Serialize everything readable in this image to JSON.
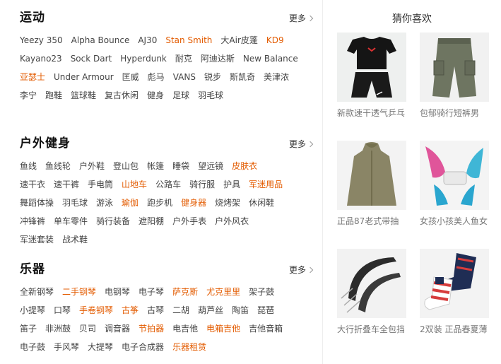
{
  "sections": [
    {
      "title": "运动",
      "more": "更多",
      "rows": [
        [
          {
            "t": "Yeezy 350"
          },
          {
            "t": "Alpha Bounce"
          },
          {
            "t": "AJ30"
          },
          {
            "t": "Stan Smith",
            "hot": true
          },
          {
            "t": "大Air皮蓬"
          },
          {
            "t": "KD9",
            "hot": true
          }
        ],
        [
          {
            "t": "Kayano23"
          },
          {
            "t": "Sock Dart"
          },
          {
            "t": "Hyperdunk"
          },
          {
            "t": "耐克"
          },
          {
            "t": "阿迪达斯"
          },
          {
            "t": "New Balance"
          }
        ],
        [
          {
            "t": "亚瑟士",
            "hot": true
          },
          {
            "t": "Under Armour"
          },
          {
            "t": "匡威"
          },
          {
            "t": "彪马"
          },
          {
            "t": "VANS"
          },
          {
            "t": "锐步"
          },
          {
            "t": "斯凯奇"
          },
          {
            "t": "美津浓"
          }
        ],
        [
          {
            "t": "李宁"
          },
          {
            "t": "跑鞋"
          },
          {
            "t": "篮球鞋"
          },
          {
            "t": "复古休闲"
          },
          {
            "t": "健身"
          },
          {
            "t": "足球"
          },
          {
            "t": "羽毛球"
          }
        ]
      ]
    },
    {
      "title": "户外健身",
      "more": "更多",
      "rows": [
        [
          {
            "t": "鱼线"
          },
          {
            "t": "鱼线轮"
          },
          {
            "t": "户外鞋"
          },
          {
            "t": "登山包"
          },
          {
            "t": "帐篷"
          },
          {
            "t": "睡袋"
          },
          {
            "t": "望远镜"
          },
          {
            "t": "皮肤衣",
            "hot": true
          }
        ],
        [
          {
            "t": "速干衣"
          },
          {
            "t": "速干裤"
          },
          {
            "t": "手电筒"
          },
          {
            "t": "山地车",
            "hot": true
          },
          {
            "t": "公路车"
          },
          {
            "t": "骑行服"
          },
          {
            "t": "护具"
          },
          {
            "t": "军迷用品",
            "hot": true
          }
        ],
        [
          {
            "t": "舞蹈体操"
          },
          {
            "t": "羽毛球"
          },
          {
            "t": "游泳"
          },
          {
            "t": "瑜伽",
            "hot": true
          },
          {
            "t": "跑步机"
          },
          {
            "t": "健身器",
            "hot": true
          },
          {
            "t": "烧烤架"
          },
          {
            "t": "休闲鞋"
          }
        ],
        [
          {
            "t": "冲锋裤"
          },
          {
            "t": "单车零件"
          },
          {
            "t": "骑行装备"
          },
          {
            "t": "遮阳棚"
          },
          {
            "t": "户外手表"
          },
          {
            "t": "户外风衣"
          }
        ],
        [
          {
            "t": "军迷套装"
          },
          {
            "t": "战术鞋"
          }
        ]
      ]
    },
    {
      "title": "乐器",
      "more": "更多",
      "rows": [
        [
          {
            "t": "全新钢琴"
          },
          {
            "t": "二手钢琴",
            "hot": true
          },
          {
            "t": "电钢琴"
          },
          {
            "t": "电子琴"
          },
          {
            "t": "萨克斯",
            "hot": true
          },
          {
            "t": "尤克里里",
            "hot": true
          },
          {
            "t": "架子鼓"
          }
        ],
        [
          {
            "t": "小提琴"
          },
          {
            "t": "口琴"
          },
          {
            "t": "手卷钢琴",
            "hot": true
          },
          {
            "t": "古筝",
            "hot": true
          },
          {
            "t": "古琴"
          },
          {
            "t": "二胡"
          },
          {
            "t": "葫芦丝"
          },
          {
            "t": "陶笛"
          },
          {
            "t": "琵琶"
          }
        ],
        [
          {
            "t": "笛子"
          },
          {
            "t": "非洲鼓"
          },
          {
            "t": "贝司"
          },
          {
            "t": "调音器"
          },
          {
            "t": "节拍器",
            "hot": true
          },
          {
            "t": "电吉他"
          },
          {
            "t": "电箱吉他",
            "hot": true
          },
          {
            "t": "吉他音箱"
          }
        ],
        [
          {
            "t": "电子鼓"
          },
          {
            "t": "手风琴"
          },
          {
            "t": "大提琴"
          },
          {
            "t": "电子合成器"
          },
          {
            "t": "乐器租赁",
            "hot": true
          }
        ]
      ]
    }
  ],
  "recommend": {
    "title": "猜你喜欢",
    "items": [
      {
        "caption": "新款速干透气乒乓",
        "icon": "sportswear-set-image"
      },
      {
        "caption": "包郁骑行短裤男",
        "icon": "cargo-shorts-image"
      },
      {
        "caption": "正品87老式带抽",
        "icon": "raincoat-image"
      },
      {
        "caption": "女孩小孩美人鱼女",
        "icon": "mermaid-fin-image"
      },
      {
        "caption": "大行折叠车全包挡",
        "icon": "bike-fender-image"
      },
      {
        "caption": "2双装 正品春夏薄",
        "icon": "socks-image"
      }
    ]
  },
  "colors": {
    "hot": "#e35b00",
    "text": "#444444",
    "caption": "#777777"
  }
}
